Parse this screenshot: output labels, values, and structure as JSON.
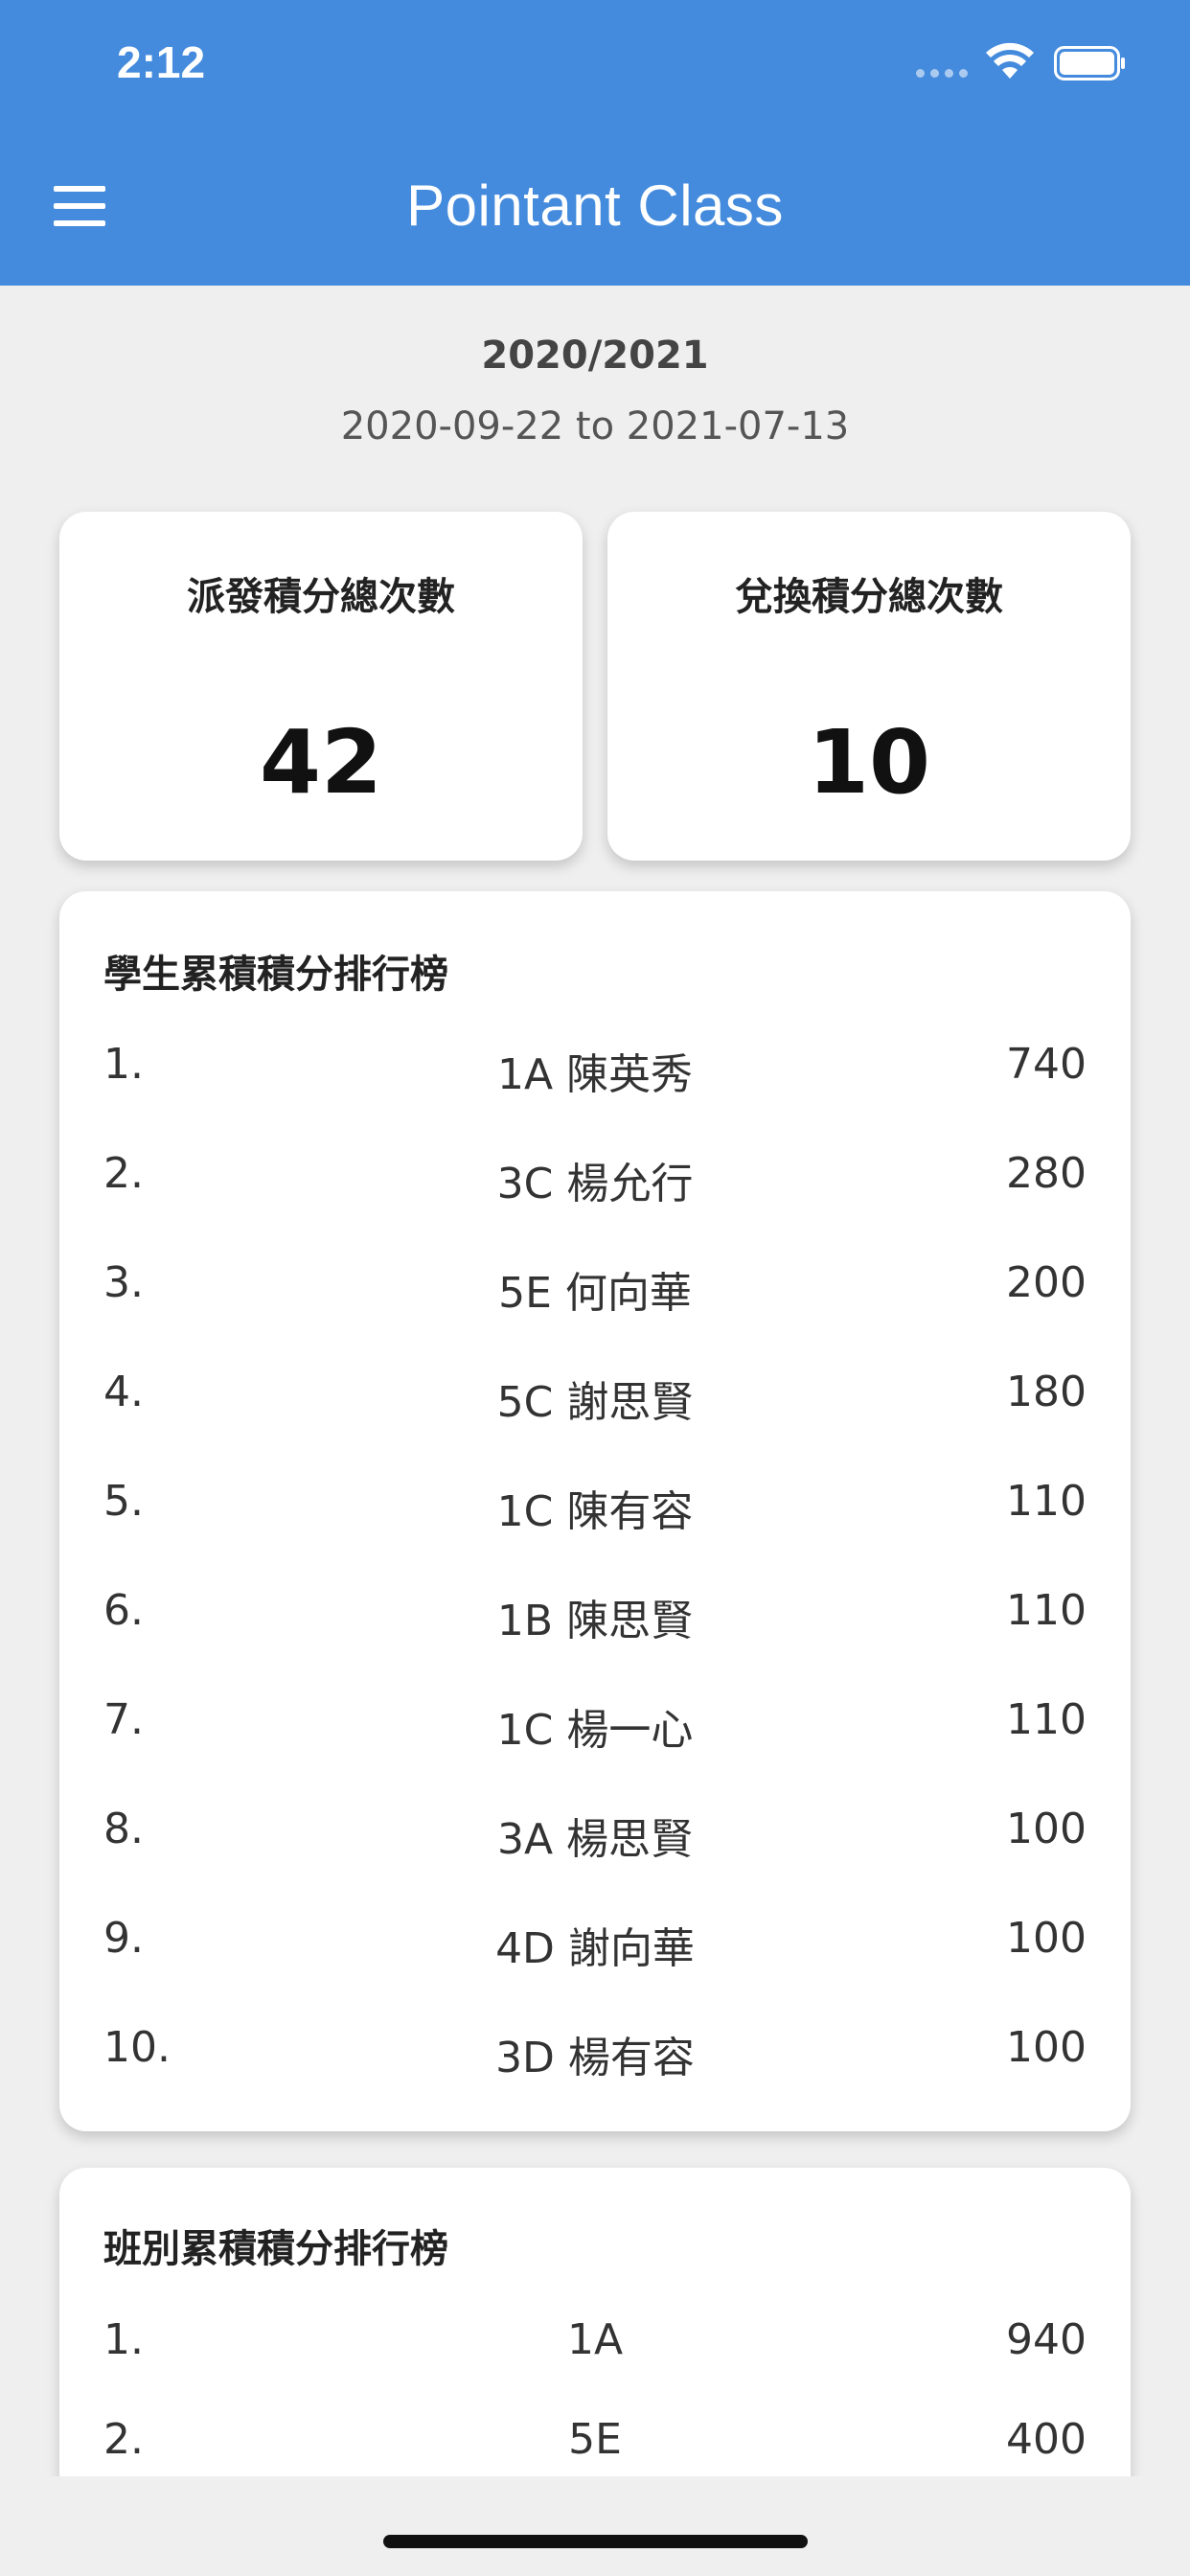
{
  "status_bar": {
    "time": "2:12"
  },
  "header": {
    "title": "Pointant Class"
  },
  "term": {
    "year": "2020/2021",
    "range": "2020-09-22 to 2021-07-13"
  },
  "stats": {
    "issued_label": "派發積分總次數",
    "issued_value": "42",
    "redeemed_label": "兌換積分總次數",
    "redeemed_value": "10"
  },
  "student_ranking": {
    "title": "學生累積積分排行榜",
    "rows": [
      {
        "rank": "1.",
        "name": "1A 陳英秀",
        "points": "740"
      },
      {
        "rank": "2.",
        "name": "3C 楊允行",
        "points": "280"
      },
      {
        "rank": "3.",
        "name": "5E 何向華",
        "points": "200"
      },
      {
        "rank": "4.",
        "name": "5C 謝思賢",
        "points": "180"
      },
      {
        "rank": "5.",
        "name": "1C 陳有容",
        "points": "110"
      },
      {
        "rank": "6.",
        "name": "1B 陳思賢",
        "points": "110"
      },
      {
        "rank": "7.",
        "name": "1C 楊一心",
        "points": "110"
      },
      {
        "rank": "8.",
        "name": "3A 楊思賢",
        "points": "100"
      },
      {
        "rank": "9.",
        "name": "4D 謝向華",
        "points": "100"
      },
      {
        "rank": "10.",
        "name": "3D 楊有容",
        "points": "100"
      }
    ]
  },
  "class_ranking": {
    "title": "班別累積積分排行榜",
    "rows": [
      {
        "rank": "1.",
        "name": "1A",
        "points": "940"
      },
      {
        "rank": "2.",
        "name": "5E",
        "points": "400"
      }
    ]
  },
  "icons": {
    "menu": "menu-icon",
    "wifi": "wifi-icon",
    "battery": "battery-icon"
  },
  "colors": {
    "header": "#448bdd",
    "background": "#efefef",
    "card": "#ffffff"
  }
}
